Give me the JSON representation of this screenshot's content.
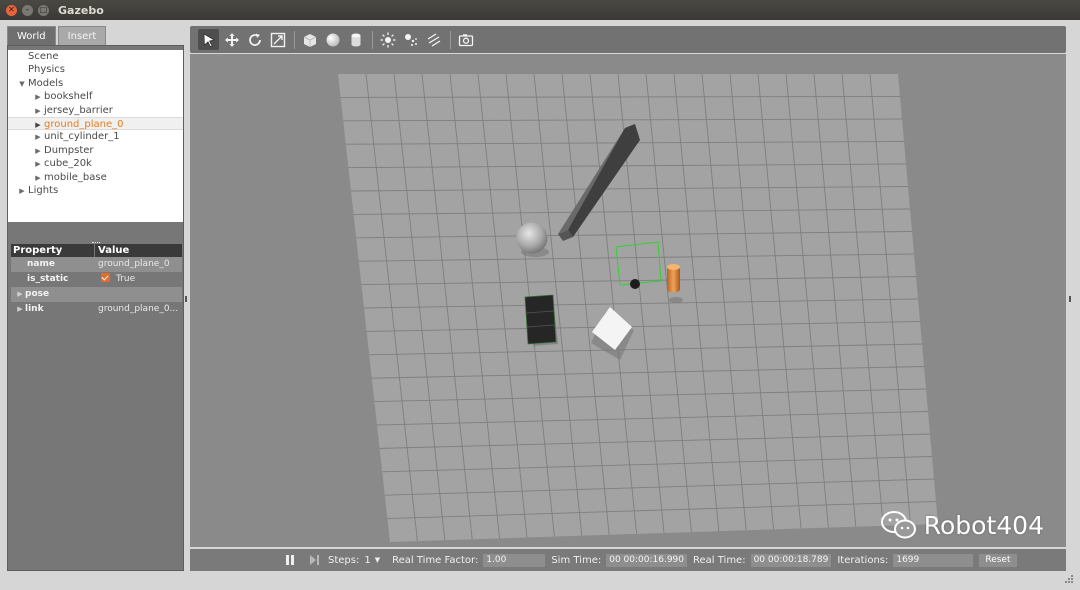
{
  "window": {
    "title": "Gazebo"
  },
  "left_panel": {
    "tabs": [
      {
        "label": "World",
        "active": true
      },
      {
        "label": "Insert",
        "active": false
      }
    ],
    "tree": {
      "scene": "Scene",
      "physics": "Physics",
      "models": "Models",
      "model_items": [
        "bookshelf",
        "jersey_barrier",
        "ground_plane_0",
        "unit_cylinder_1",
        "Dumpster",
        "cube_20k",
        "mobile_base"
      ],
      "selected_model": "ground_plane_0",
      "lights": "Lights"
    },
    "properties": {
      "header_property": "Property",
      "header_value": "Value",
      "rows": [
        {
          "key": "name",
          "value": "ground_plane_0"
        },
        {
          "key": "is_static",
          "value": "True"
        },
        {
          "key": "pose",
          "value": ""
        },
        {
          "key": "link",
          "value": "ground_plane_0..."
        }
      ]
    }
  },
  "toolbar": {
    "tools": [
      "select-arrow-icon",
      "translate-icon",
      "rotate-icon",
      "scale-icon",
      "box-icon",
      "sphere-icon",
      "cylinder-icon",
      "point-light-icon",
      "spot-light-icon",
      "directional-light-icon",
      "screenshot-icon"
    ]
  },
  "bottom_bar": {
    "steps_label": "Steps:",
    "steps_value": "1",
    "real_time_factor_label": "Real Time Factor:",
    "real_time_factor_value": "1.00",
    "sim_time_label": "Sim Time:",
    "sim_time_value": "00 00:00:16.990",
    "real_time_label": "Real Time:",
    "real_time_value": "00 00:00:18.789",
    "iterations_label": "Iterations:",
    "iterations_value": "1699",
    "reset_label": "Reset"
  },
  "watermark": {
    "text": "Robot404"
  },
  "colors": {
    "selected_text": "#e87a1f",
    "selection_box": "#2fd12f",
    "checkbox": "#e86a28"
  }
}
